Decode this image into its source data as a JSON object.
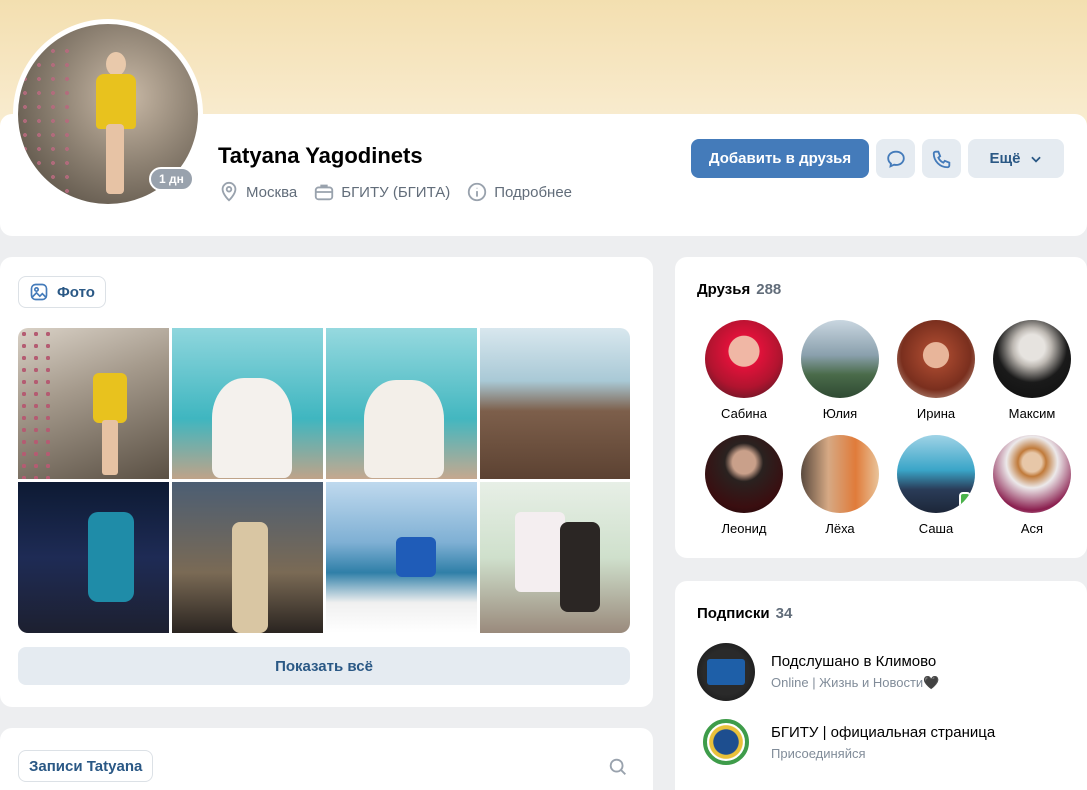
{
  "profile": {
    "name": "Tatyana Yagodinets",
    "last_seen_badge": "1 дн",
    "city": "Москва",
    "university": "БГИТУ (БГИТА)",
    "details_label": "Подробнее"
  },
  "actions": {
    "add_friend": "Добавить в друзья",
    "more": "Ещё"
  },
  "photos": {
    "tab_label": "Фото",
    "show_all": "Показать всё"
  },
  "posts": {
    "tab_label": "Записи Tatyana"
  },
  "friends": {
    "title": "Друзья",
    "count": "288",
    "items": [
      {
        "name": "Сабина"
      },
      {
        "name": "Юлия"
      },
      {
        "name": "Ирина"
      },
      {
        "name": "Максим"
      },
      {
        "name": "Леонид"
      },
      {
        "name": "Лёха"
      },
      {
        "name": "Саша"
      },
      {
        "name": "Ася"
      }
    ]
  },
  "subscriptions": {
    "title": "Подписки",
    "count": "34",
    "items": [
      {
        "title": "Подслушано в Климово",
        "desc": "Online | Жизнь и Новости🖤"
      },
      {
        "title": "БГИТУ | официальная страница",
        "desc": "Присоединяйся"
      }
    ]
  },
  "colors": {
    "accent": "#447bba",
    "link": "#2a5885",
    "secondary_button": "#e5ebf1",
    "background": "#edeef0",
    "online": "#4bb34b"
  }
}
